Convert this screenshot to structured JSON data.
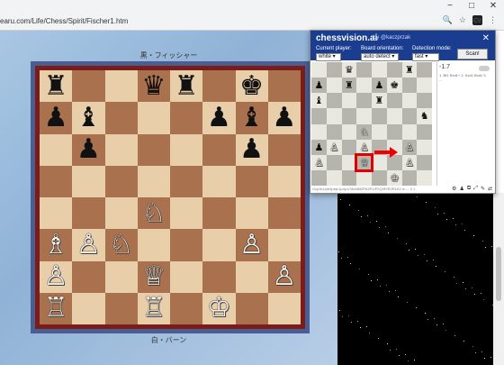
{
  "browser": {
    "url": "earu.com/Life/Chess/Spirit/Fischer1.htm",
    "window_controls": [
      "−",
      "□",
      "✕"
    ],
    "url_icons": [
      "🔍",
      "☆",
      "⋮"
    ],
    "ext_icon_label": "cv"
  },
  "page": {
    "top_player": "黒・フィッシャー",
    "bottom_player": "白・バーン",
    "board": [
      [
        "♜",
        "",
        "",
        "♛",
        "♜",
        "",
        "♚",
        ""
      ],
      [
        "♟",
        "♝",
        "",
        "",
        "",
        "♟",
        "♝",
        "♟"
      ],
      [
        "",
        "♟",
        "",
        "",
        "",
        "",
        "♟",
        ""
      ],
      [
        "",
        "",
        "",
        "",
        "",
        "",
        "",
        ""
      ],
      [
        "",
        "",
        "",
        "♘",
        "",
        "",
        "",
        ""
      ],
      [
        "♗",
        "♙",
        "♘",
        "",
        "",
        "",
        "♙",
        ""
      ],
      [
        "♙",
        "",
        "",
        "♕",
        "",
        "",
        "",
        "♙"
      ],
      [
        "♖",
        "",
        "",
        "♖",
        "",
        "♔",
        "",
        ""
      ]
    ],
    "colors": {
      "light_square": "#e9ceaa",
      "dark_square": "#a9714d",
      "frame": "#4a5e92",
      "border": "#7a1c1a"
    }
  },
  "extension": {
    "brand": "chessvision.ai",
    "by": "by @kaczprzak",
    "close": "✕",
    "current_player_label": "Current player:",
    "current_player_value": "white ▾",
    "orientation_label": "Board orientation:",
    "orientation_value": "auto detect ▾",
    "detection_label": "Detection mode:",
    "detection_value": "fast ▾",
    "scan_label": "Scan!",
    "score": "-1.7",
    "lines": "1. Bf1 Rxd1+ 2. Kxd1 Bxd1 3. ...",
    "fen": "r2qr1k1/pb3pbp/1p4p1/3N4/8/BPN3P1/P2Q3P/R2R1K2 w - - 0 1",
    "toolbar": [
      "⚙",
      "♟",
      "⧉",
      "⤢",
      "✎",
      "⇄"
    ],
    "mini_board": [
      [
        "",
        "",
        "♛",
        "",
        "",
        "",
        "♜",
        ""
      ],
      [
        "♟",
        "",
        "♜",
        "",
        "♟",
        "♚",
        "",
        ""
      ],
      [
        "♝",
        "",
        "",
        "",
        "♜",
        "",
        "",
        ""
      ],
      [
        "",
        "",
        "",
        "",
        "",
        "",
        "",
        "♞"
      ],
      [
        "",
        "",
        "",
        "♘",
        "",
        "",
        "",
        ""
      ],
      [
        "♟",
        "♙",
        "",
        "♙",
        "",
        "",
        "♙",
        ""
      ],
      [
        "♙",
        "",
        "",
        "♕",
        "",
        "",
        "♙",
        ""
      ],
      [
        "",
        "",
        "",
        "",
        "",
        "♔",
        "",
        ""
      ]
    ],
    "highlight": {
      "row": 6,
      "col": 3
    }
  }
}
